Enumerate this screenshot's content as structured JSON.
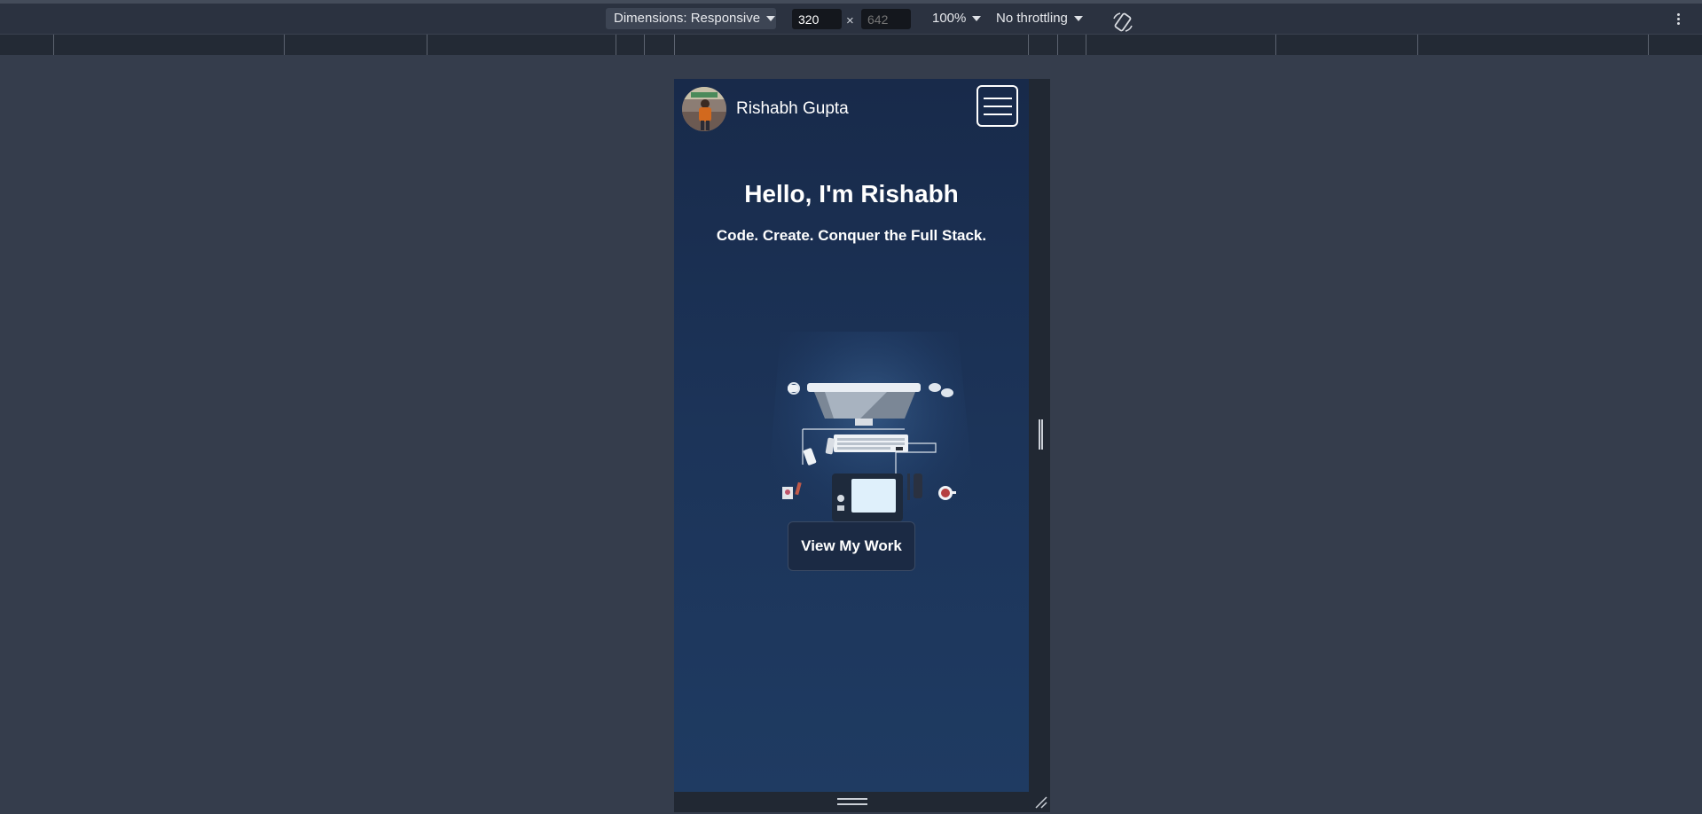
{
  "devtools": {
    "dimensions_label": "Dimensions: Responsive",
    "width_value": "320",
    "height_placeholder": "642",
    "times_symbol": "×",
    "zoom_label": "100%",
    "throttling_label": "No throttling"
  },
  "site": {
    "brand_name": "Rishabh Gupta",
    "hero_title": "Hello, I'm Rishabh",
    "hero_subtitle": "Code. Create. Conquer the Full Stack.",
    "cta_label": "View My Work"
  },
  "colors": {
    "devtools_bg": "#353d4c",
    "toolbar_bg": "#2b3240",
    "page_gradient_top": "#182a4a",
    "page_gradient_bottom": "#1f3b62",
    "cta_bg": "#1b2a44"
  },
  "icons": {
    "menu": "hamburger-menu-icon",
    "rotate": "rotate-device-icon",
    "more": "more-options-icon"
  }
}
